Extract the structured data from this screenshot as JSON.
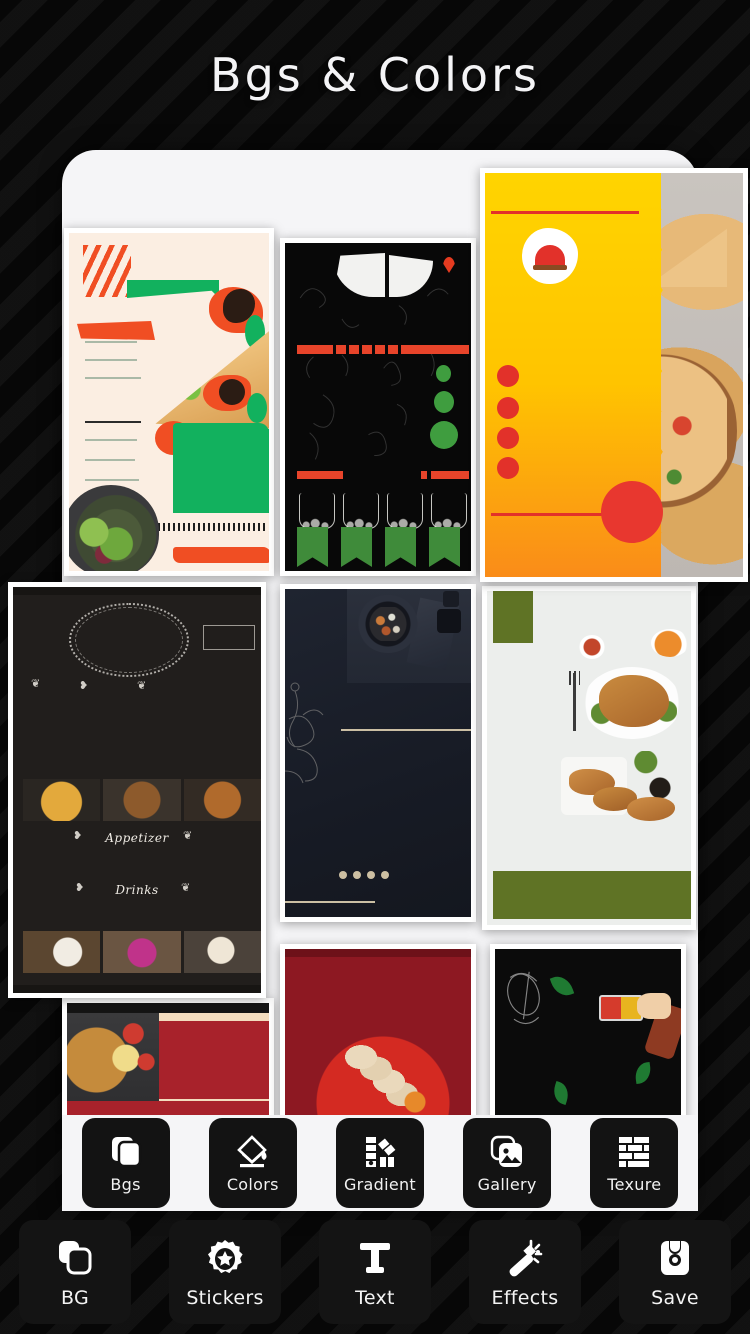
{
  "header": {
    "title": "Bgs & Colors"
  },
  "toolbar_primary": {
    "items": [
      {
        "label": "Bgs",
        "icon": "layers-icon"
      },
      {
        "label": "Colors",
        "icon": "paint-bucket-icon"
      },
      {
        "label": "Gradient",
        "icon": "color-swatches-icon"
      },
      {
        "label": "Gallery",
        "icon": "gallery-icon"
      },
      {
        "label": "Texure",
        "icon": "brick-wall-icon"
      }
    ]
  },
  "toolbar_bottom": {
    "items": [
      {
        "label": "BG",
        "icon": "layers-outline-icon"
      },
      {
        "label": "Stickers",
        "icon": "badge-star-icon"
      },
      {
        "label": "Text",
        "icon": "text-t-icon"
      },
      {
        "label": "Effects",
        "icon": "magic-wand-icon"
      },
      {
        "label": "Save",
        "icon": "floppy-disk-icon"
      }
    ]
  },
  "templates": [
    {
      "id": "t1",
      "name": "cream-pizza-poster",
      "style": "cream background with orange and green brush shapes, pizza slice and salad bowl"
    },
    {
      "id": "t2",
      "name": "chalkboard-pizza-menu",
      "style": "black chalkboard with white pizza illustration, red bars and green banners"
    },
    {
      "id": "t3",
      "name": "yellow-orange-pizza-flyer",
      "style": "yellow to orange gradient wave with pizza photography and red dots"
    },
    {
      "id": "t4",
      "name": "dark-restaurant-menu",
      "style": "dark brown menu with floral wreath and food photo strips",
      "labels": {
        "appetizer": "Appetizer",
        "drinks": "Drinks"
      }
    },
    {
      "id": "t5",
      "name": "navy-plate-menu",
      "style": "dark navy table with bowl, botanical line art and four dots"
    },
    {
      "id": "t6",
      "name": "white-olive-chicken-menu",
      "style": "white background with olive green blocks and roast chicken plate"
    },
    {
      "id": "t7",
      "name": "roast-chicken-red-card",
      "style": "beige and red card with roast chicken photo"
    },
    {
      "id": "t8",
      "name": "red-plate-card",
      "style": "deep red background with red plate of rolls"
    },
    {
      "id": "t9",
      "name": "dark-doodle-card",
      "style": "black card with green leaves, red-yellow box and hand illustration"
    }
  ],
  "colors": {
    "page_background": "#080808",
    "sheet_background": "#f5f5f7",
    "button_background": "#131313",
    "button_text": "#f2f2f2",
    "title_text": "#f4f4f6",
    "accent_orange": "#f04e23",
    "accent_green": "#12b15e",
    "accent_yellow": "#ffd400",
    "accent_red": "#e2312a",
    "accent_olive": "#5f7325"
  }
}
